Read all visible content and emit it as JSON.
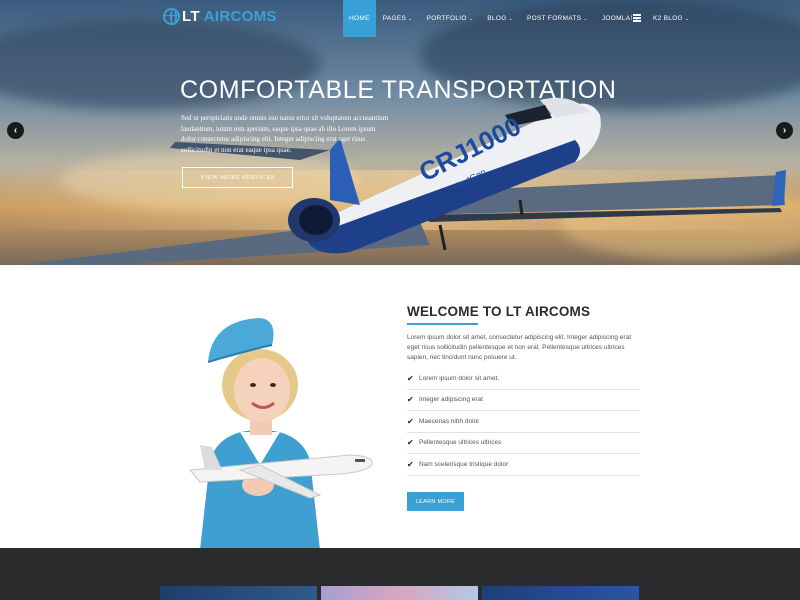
{
  "brand": {
    "prefix": "LT",
    "name": "AIRCOMS"
  },
  "nav": {
    "items": [
      {
        "label": "HOME",
        "active": true,
        "has_caret": false
      },
      {
        "label": "PAGES",
        "active": false,
        "has_caret": true
      },
      {
        "label": "PORTFOLIO",
        "active": false,
        "has_caret": true
      },
      {
        "label": "BLOG",
        "active": false,
        "has_caret": true
      },
      {
        "label": "POST FORMATS",
        "active": false,
        "has_caret": true
      },
      {
        "label": "JOOMLA!",
        "active": false,
        "has_caret": true
      },
      {
        "label": "K2 BLOG",
        "active": false,
        "has_caret": true
      }
    ],
    "caret": "⌄"
  },
  "hero": {
    "title": "COMFORTABLE TRANSPORTATION",
    "text": "Sed ut perspiciatis unde omnis iste natus error sit voluptatem accusantium laudantium, totam rem aperiam, eaque ipsa quae ab illo Lorem ipsum dolor consectetur adipiscing elit. Integer adipiscing erat eget risus sollicitudin et non erat eaque ipsa quae.",
    "button_label": "VIEW MORE SERVICES",
    "plane_livery": "CRJ1000",
    "plane_sub": "NextGen",
    "prev_icon": "‹",
    "next_icon": "›"
  },
  "welcome": {
    "title": "WELCOME TO LT AIRCOMS",
    "text": "Lorem ipsum dolor sit amet, consectetur adipiscing elit. Integer adipiscing erat eget risus sollicitudin pellentesque et non erat. Pellentesque ultrices ultrices sapien, nec tincidunt nunc posuere ut.",
    "check_icon": "✔",
    "items": [
      "Lorem ipsum dolor sit amet.",
      "Integer adipiscing erat",
      "Maecenas nibh dolor",
      "Pellentesque ultrices ultrices",
      "Nam scelerisque tristique dolor"
    ],
    "button_label": "LEARN MORE"
  },
  "colors": {
    "accent": "#39a0d8",
    "dark": "#2a2b2d",
    "text": "#555555"
  }
}
